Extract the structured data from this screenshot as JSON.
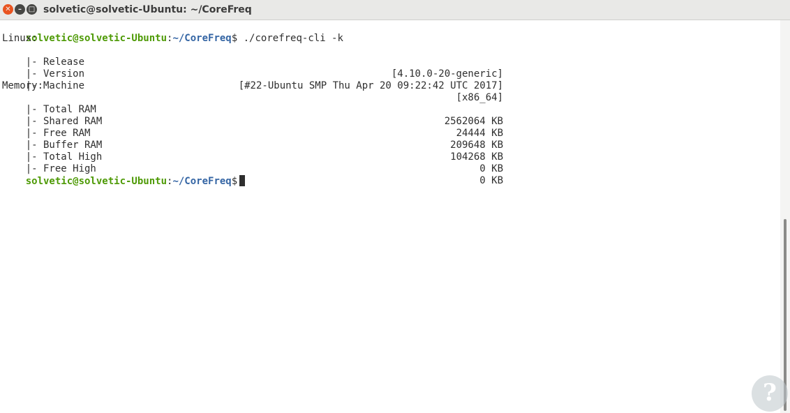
{
  "window": {
    "title": "solvetic@solvetic-Ubuntu: ~/CoreFreq"
  },
  "prompt": {
    "user_host": "solvetic@solvetic-Ubuntu",
    "sep": ":",
    "path": "~/CoreFreq",
    "symbol": "$"
  },
  "command": " ./corefreq-cli -k",
  "sections": {
    "linux": {
      "header": "Linux:",
      "rows": [
        {
          "label": "|- Release",
          "value": "[4.10.0-20-generic]"
        },
        {
          "label": "|- Version",
          "value": "[#22-Ubuntu SMP Thu Apr 20 09:22:42 UTC 2017]"
        },
        {
          "label": "|- Machine",
          "value": "[x86_64]"
        }
      ]
    },
    "memory": {
      "header": "Memory:",
      "rows": [
        {
          "label": "|- Total RAM",
          "value": "2562064 KB"
        },
        {
          "label": "|- Shared RAM",
          "value": "24444 KB"
        },
        {
          "label": "|- Free RAM",
          "value": "209648 KB"
        },
        {
          "label": "|- Buffer RAM",
          "value": "104268 KB"
        },
        {
          "label": "|- Total High",
          "value": "0 KB"
        },
        {
          "label": "|- Free High",
          "value": "0 KB"
        }
      ]
    }
  },
  "icons": {
    "close": "close-icon",
    "minimize": "minimize-icon",
    "maximize": "maximize-icon",
    "watermark": "watermark-logo"
  },
  "colors": {
    "prompt_user": "#4e9a06",
    "prompt_path": "#3465a4",
    "close_button": "#e95420"
  }
}
